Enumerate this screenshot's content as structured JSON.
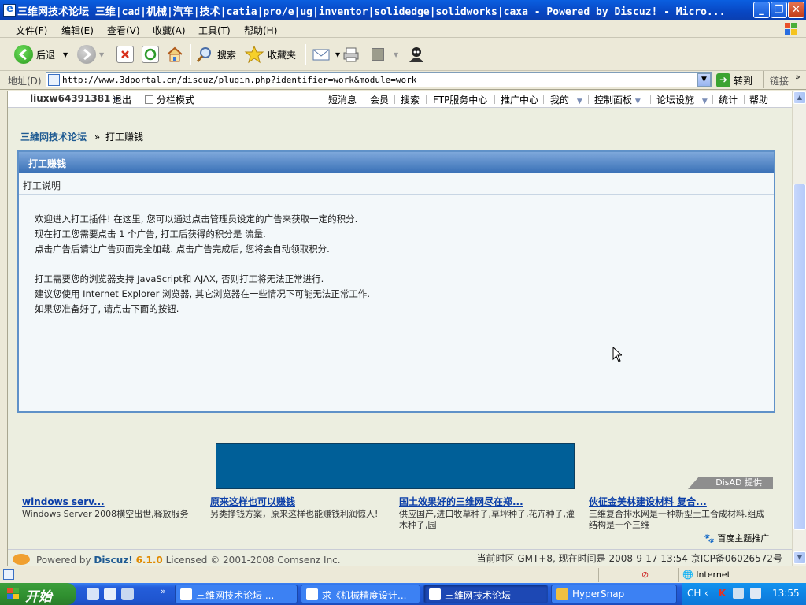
{
  "window": {
    "title": "三维网技术论坛 三维|cad|机械|汽车|技术|catia|pro/e|ug|inventor|solidedge|solidworks|caxa - Powered by Discuz! - Micro..."
  },
  "menu": [
    "文件(F)",
    "编辑(E)",
    "查看(V)",
    "收藏(A)",
    "工具(T)",
    "帮助(H)"
  ],
  "toolbar": {
    "back": "后退",
    "search": "搜索",
    "favorites": "收藏夹"
  },
  "address": {
    "label": "地址(D)",
    "url": "http://www.3dportal.cn/discuz/plugin.php?identifier=work&module=work",
    "go": "转到",
    "links": "链接"
  },
  "forum_nav": {
    "username": "liuxw64391381",
    "logout": "退出",
    "split_mode": "分栏模式",
    "items": [
      "短消息",
      "会员",
      "搜索",
      "FTP服务中心",
      "推广中心",
      "我的",
      "控制面板",
      "论坛设施",
      "统计",
      "帮助"
    ]
  },
  "breadcrumb": {
    "home": "三維网技术论坛",
    "sep": "»",
    "current": "打工赚钱"
  },
  "panel": {
    "title": "打工赚钱",
    "subtitle": "打工说明",
    "lines": [
      "欢迎进入打工插件! 在这里, 您可以通过点击管理员设定的广告来获取一定的积分.",
      "现在打工您需要点击  1 个广告, 打工后获得的积分是  流量.",
      "点击广告后请让广告页面完全加载. 点击广告完成后, 您将会自动领取积分.",
      "",
      "打工需要您的浏览器支持  JavaScript和  AJAX, 否则打工将无法正常进行.",
      "建议您使用  Internet Explorer 浏览器, 其它浏览器在一些情况下可能无法正常工作.",
      "如果您准备好了, 请点击下面的按钮."
    ]
  },
  "ads": {
    "disad": "DisAD 提供",
    "columns": [
      {
        "title": "windows serv...",
        "desc": "Windows Server 2008横空出世,释放服务"
      },
      {
        "title": "原来这样也可以赚钱",
        "desc": "另类挣钱方案，原来这样也能赚钱利润惊人!"
      },
      {
        "title": "国土效果好的三维网尽在郑...",
        "desc": "供应国产,进口牧草种子,草坪种子,花卉种子,灌木种子,园"
      },
      {
        "title": "伙征金美林建设材料 复合...",
        "desc": "三维复合排水网是一种新型土工合成材料.组成结构是一个三维"
      }
    ],
    "baidu": "百度主题推广"
  },
  "footer": {
    "powered": "Powered by",
    "discuz": "Discuz!",
    "version": "6.1.0",
    "license": "Licensed © 2001-2008 Comsenz Inc.",
    "time": "当前时区  GMT+8, 现在时间是  2008-9-17 13:54 京ICP备06026572号"
  },
  "statusbar": {
    "zone": "Internet"
  },
  "taskbar": {
    "start": "开始",
    "tasks": [
      {
        "label": "三維网技术论坛 ...",
        "active": false
      },
      {
        "label": "求《机械精度设计...",
        "active": false
      },
      {
        "label": "三維网技术论坛",
        "active": true
      },
      {
        "label": "HyperSnap",
        "active": false
      }
    ],
    "lang": "CH",
    "clock": "13:55"
  }
}
